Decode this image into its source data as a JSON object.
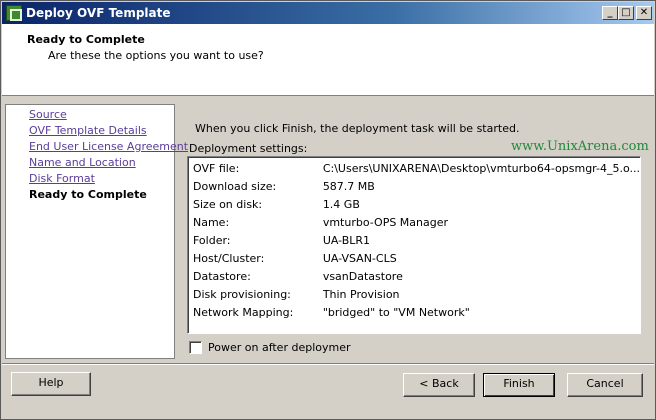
{
  "window": {
    "title": "Deploy OVF Template",
    "controls": {
      "minimize": "_",
      "maximize": "□",
      "close": "✕"
    }
  },
  "header": {
    "title": "Ready to Complete",
    "subtitle": "Are these the options you want to use?"
  },
  "nav": {
    "items": [
      {
        "label": "Source",
        "state": "link"
      },
      {
        "label": "OVF Template Details",
        "state": "link"
      },
      {
        "label": "End User License Agreement",
        "state": "link"
      },
      {
        "label": "Name and Location",
        "state": "link"
      },
      {
        "label": "Disk Format",
        "state": "link"
      },
      {
        "label": "Ready to Complete",
        "state": "current"
      }
    ]
  },
  "content": {
    "intro": "When you click Finish, the deployment task will be started.",
    "watermark": "www.UnixArena.com",
    "settings_label": "Deployment settings:",
    "settings": [
      {
        "key": "OVF file:",
        "value": "C:\\Users\\UNIXARENA\\Desktop\\vmturbo64-opsmgr-4_5.o..."
      },
      {
        "key": "Download size:",
        "value": "587.7 MB"
      },
      {
        "key": "Size on disk:",
        "value": "1.4 GB"
      },
      {
        "key": "Name:",
        "value": "vmturbo-OPS Manager"
      },
      {
        "key": "Folder:",
        "value": "UA-BLR1"
      },
      {
        "key": "Host/Cluster:",
        "value": "UA-VSAN-CLS"
      },
      {
        "key": "Datastore:",
        "value": "vsanDatastore"
      },
      {
        "key": "Disk provisioning:",
        "value": "Thin Provision"
      },
      {
        "key": "Network Mapping:",
        "value": "\"bridged\" to \"VM Network\""
      }
    ],
    "power_on_checkbox": {
      "label": "Power on after deploymer",
      "checked": false
    }
  },
  "footer": {
    "help": "Help",
    "back": "< Back",
    "finish": "Finish",
    "cancel": "Cancel"
  }
}
